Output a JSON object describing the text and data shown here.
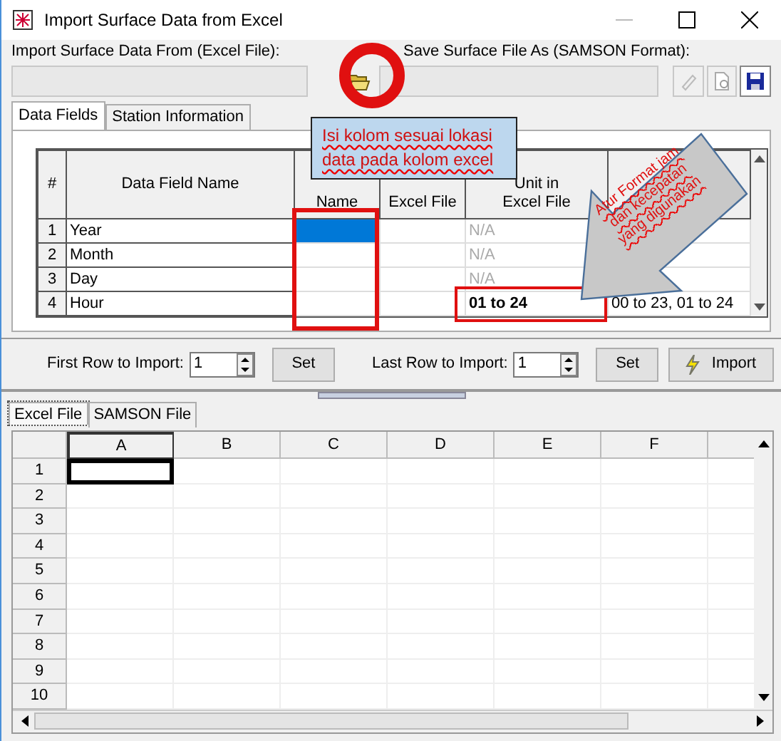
{
  "window": {
    "title": "Import Surface Data from Excel"
  },
  "import_from": {
    "label": "Import Surface Data From (Excel File):"
  },
  "save_as": {
    "label": "Save Surface File As (SAMSON Format):"
  },
  "tabs": [
    {
      "label": "Data Fields",
      "selected": true
    },
    {
      "label": "Station Information",
      "selected": false
    }
  ],
  "fields_table": {
    "columns": [
      "#",
      "Data Field Name",
      "Name",
      "Excel File",
      "Unit in Excel File"
    ],
    "rows": [
      {
        "num": "1",
        "name": "Year",
        "selected": true,
        "unit": "N/A",
        "unit_enabled": false
      },
      {
        "num": "2",
        "name": "Month",
        "selected": false,
        "unit": "N/A",
        "unit_enabled": false
      },
      {
        "num": "3",
        "name": "Day",
        "selected": false,
        "unit": "N/A",
        "unit_enabled": false
      },
      {
        "num": "4",
        "name": "Hour",
        "selected": false,
        "unit": "01 to 24",
        "unit_enabled": true,
        "column_6": "00 to 23, 01 to 24"
      }
    ]
  },
  "first_row": {
    "label": "First Row to Import:",
    "value": "1",
    "button": "Set"
  },
  "last_row": {
    "label": "Last Row to Import:",
    "value": "1",
    "button": "Set"
  },
  "import_button": "Import",
  "sheet_tabs": [
    {
      "label": "Excel File",
      "selected": true
    },
    {
      "label": "SAMSON File",
      "selected": false
    }
  ],
  "sheet": {
    "columns": [
      "A",
      "B",
      "C",
      "D",
      "E",
      "F"
    ],
    "rows": [
      {
        "label": "1",
        "active": true
      },
      {
        "label": "2",
        "active": false
      },
      {
        "label": "3",
        "active": false
      },
      {
        "label": "4",
        "active": false
      },
      {
        "label": "5",
        "active": false
      },
      {
        "label": "6",
        "active": false
      },
      {
        "label": "7",
        "active": false
      },
      {
        "label": "8",
        "active": false
      },
      {
        "label": "9",
        "active": false
      },
      {
        "label": "10",
        "active": false
      }
    ]
  },
  "annotations": {
    "callout": "Isi kolom sesuai lokasi data pada kolom excel",
    "arrow_note": "Atur Format jam dan kecepatan yang digunakan"
  }
}
